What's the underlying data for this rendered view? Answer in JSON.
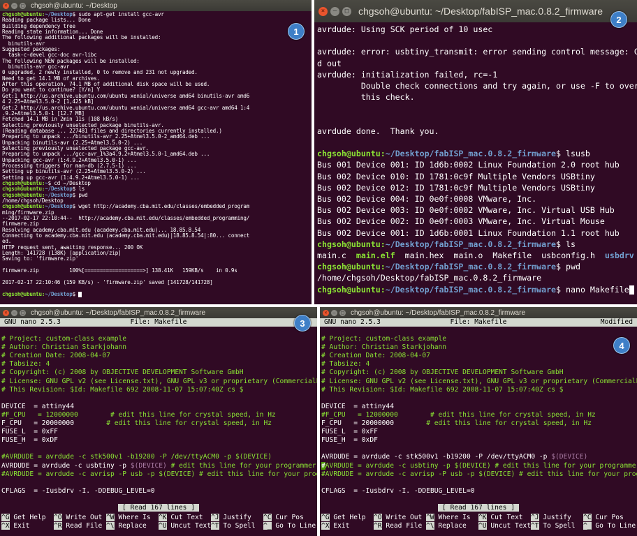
{
  "badges": [
    "1",
    "2",
    "3",
    "4"
  ],
  "window1": {
    "title": "chgsoh@ubuntu: ~/Desktop",
    "lines": [
      {
        "p": "chgsoh@ubuntu:",
        "d": "~/Desktop",
        "c": "$ sudo apt-get install gcc-avr"
      },
      {
        "t": "Reading package lists... Done"
      },
      {
        "t": "Building dependency tree"
      },
      {
        "t": "Reading state information... Done"
      },
      {
        "t": "The following additional packages will be installed:"
      },
      {
        "t": "  binutils-avr"
      },
      {
        "t": "Suggested packages:"
      },
      {
        "t": "  task-c-devel gcc-doc avr-libc"
      },
      {
        "t": "The following NEW packages will be installed:"
      },
      {
        "t": "  binutils-avr gcc-avr"
      },
      {
        "t": "0 upgraded, 2 newly installed, 0 to remove and 231 not upgraded."
      },
      {
        "t": "Need to get 14.1 MB of archives."
      },
      {
        "t": "After this operation, 74.1 MB of additional disk space will be used."
      },
      {
        "t": "Do you want to continue? [Y/n] Y"
      },
      {
        "t": "Get:1 http://us.archive.ubuntu.com/ubuntu xenial/universe amd64 binutils-avr amd6"
      },
      {
        "t": "4 2.25+Atmel3.5.0-2 [1,425 kB]"
      },
      {
        "t": "Get:2 http://us.archive.ubuntu.com/ubuntu xenial/universe amd64 gcc-avr amd64 1:4"
      },
      {
        "t": ".9.2+Atmel3.5.0-1 [12.7 MB]"
      },
      {
        "t": "Fetched 14.1 MB in 2min 11s (108 kB/s)"
      },
      {
        "t": "Selecting previously unselected package binutils-avr."
      },
      {
        "t": "(Reading database ... 227481 files and directories currently installed.)"
      },
      {
        "t": "Preparing to unpack .../binutils-avr_2.25+Atmel3.5.0-2_amd64.deb ..."
      },
      {
        "t": "Unpacking binutils-avr (2.25+Atmel3.5.0-2) ..."
      },
      {
        "t": "Selecting previously unselected package gcc-avr."
      },
      {
        "t": "Preparing to unpack .../gcc-avr_1%3a4.9.2+Atmel3.5.0-1_amd64.deb ..."
      },
      {
        "t": "Unpacking gcc-avr (1:4.9.2+Atmel3.5.0-1) ..."
      },
      {
        "t": "Processing triggers for man-db (2.7.5-1) ..."
      },
      {
        "t": "Setting up binutils-avr (2.25+Atmel3.5.0-2) ..."
      },
      {
        "t": "Setting up gcc-avr (1:4.9.2+Atmel3.5.0-1) ..."
      },
      {
        "p": "chgsoh@ubuntu:",
        "d": "~",
        "c": "$ cd ~/Desktop"
      },
      {
        "p": "chgsoh@ubuntu:",
        "d": "~/Desktop",
        "c": "$ ls"
      },
      {
        "p": "chgsoh@ubuntu:",
        "d": "~/Desktop",
        "c": "$ pwd"
      },
      {
        "t": "/home/chgsoh/Desktop"
      },
      {
        "p": "chgsoh@ubuntu:",
        "d": "~/Desktop",
        "c": "$ wget http://academy.cba.mit.edu/classes/embedded_program"
      },
      {
        "t": "ming/firmware.zip"
      },
      {
        "t": "--2017-02-17 22:10:44--  http://academy.cba.mit.edu/classes/embedded_programming/"
      },
      {
        "t": "firmware.zip"
      },
      {
        "t": "Resolving academy.cba.mit.edu (academy.cba.mit.edu)... 18.85.8.54"
      },
      {
        "t": "Connecting to academy.cba.mit.edu (academy.cba.mit.edu)|18.85.8.54|:80... connect"
      },
      {
        "t": "ed."
      },
      {
        "t": "HTTP request sent, awaiting response... 200 OK"
      },
      {
        "t": "Length: 141728 (138K) [application/zip]"
      },
      {
        "t": "Saving to: 'firmware.zip'"
      },
      {
        "t": ""
      },
      {
        "t": "firmware.zip          100%[===================>] 138.41K   159KB/s    in 0.9s"
      },
      {
        "t": ""
      },
      {
        "t": "2017-02-17 22:10:46 (159 KB/s) - 'firmware.zip' saved [141728/141728]"
      },
      {
        "t": ""
      },
      {
        "p": "chgsoh@ubuntu:",
        "d": "~/Desktop",
        "c": "$ ",
        "cursor": true
      }
    ]
  },
  "window2": {
    "title": "chgsoh@ubuntu: ~/Desktop/fabISP_mac.0.8.2_firmware",
    "lines": [
      {
        "t": "avrdude: Using SCK period of 10 usec"
      },
      {
        "t": ""
      },
      {
        "t": "avrdude: error: usbtiny_transmit: error sending control message: Connection time"
      },
      {
        "t": "d out"
      },
      {
        "t": "avrdude: initialization failed, rc=-1"
      },
      {
        "t": "         Double check connections and try again, or use -F to override"
      },
      {
        "t": "         this check."
      },
      {
        "t": ""
      },
      {
        "t": ""
      },
      {
        "t": "avrdude done.  Thank you."
      },
      {
        "t": ""
      },
      {
        "p": "chgsoh@ubuntu:",
        "d": "~/Desktop/fabISP_mac.0.8.2_firmware",
        "c": "$ lsusb"
      },
      {
        "t": "Bus 001 Device 001: ID 1d6b:0002 Linux Foundation 2.0 root hub"
      },
      {
        "t": "Bus 002 Device 010: ID 1781:0c9f Multiple Vendors USBtiny"
      },
      {
        "t": "Bus 002 Device 012: ID 1781:0c9f Multiple Vendors USBtiny"
      },
      {
        "t": "Bus 002 Device 004: ID 0e0f:0008 VMware, Inc."
      },
      {
        "t": "Bus 002 Device 003: ID 0e0f:0002 VMware, Inc. Virtual USB Hub"
      },
      {
        "t": "Bus 002 Device 002: ID 0e0f:0003 VMware, Inc. Virtual Mouse"
      },
      {
        "t": "Bus 002 Device 001: ID 1d6b:0001 Linux Foundation 1.1 root hub"
      },
      {
        "p": "chgsoh@ubuntu:",
        "d": "~/Desktop/fabISP_mac.0.8.2_firmware",
        "c": "$ ls"
      },
      {
        "ls": true
      },
      {
        "p": "chgsoh@ubuntu:",
        "d": "~/Desktop/fabISP_mac.0.8.2_firmware",
        "c": "$ pwd"
      },
      {
        "t": "/home/chgsoh/Desktop/fabISP_mac.0.8.2_firmware"
      },
      {
        "p": "chgsoh@ubuntu:",
        "d": "~/Desktop/fabISP_mac.0.8.2_firmware",
        "c": "$ nano Makefile",
        "cursor": true
      }
    ],
    "ls_files": [
      {
        "n": "main.c",
        "k": "f"
      },
      {
        "n": "main.elf",
        "k": "x"
      },
      {
        "n": "main.hex",
        "k": "f"
      },
      {
        "n": "main.o",
        "k": "f"
      },
      {
        "n": "Makefile",
        "k": "f"
      },
      {
        "n": "usbconfig.h",
        "k": "f"
      },
      {
        "n": "usbdrv",
        "k": "d"
      }
    ]
  },
  "nano": {
    "window_title": "chgsoh@ubuntu: ~/Desktop/fabISP_mac.0.8.2_firmware",
    "version": "GNU nano 2.5.3",
    "file": "File: Makefile",
    "modified_label": "Modified",
    "status": "[ Read 167 lines ]",
    "help_rows": [
      [
        {
          "k": "^G",
          "l": " Get Help"
        },
        {
          "k": "^O",
          "l": " Write Out"
        },
        {
          "k": "^W",
          "l": " Where Is"
        },
        {
          "k": "^K",
          "l": " Cut Text"
        },
        {
          "k": "^J",
          "l": " Justify"
        },
        {
          "k": "^C",
          "l": " Cur Pos"
        }
      ],
      [
        {
          "k": "^X",
          "l": " Exit"
        },
        {
          "k": "^R",
          "l": " Read File"
        },
        {
          "k": "^\\",
          "l": " Replace"
        },
        {
          "k": "^U",
          "l": " Uncut Text"
        },
        {
          "k": "^T",
          "l": " To Spell"
        },
        {
          "k": "^_",
          "l": " Go To Line"
        }
      ]
    ],
    "header_lines": [
      "# Project: custom-class example",
      "# Author: Christian Starkjohann",
      "# Creation Date: 2008-04-07",
      "# Tabsize: 4",
      "# Copyright: (c) 2008 by OBJECTIVE DEVELOPMENT Software GmbH",
      "# License: GNU GPL v2 (see License.txt), GNU GPL v3 or proprietary (CommercialL$",
      "# This Revision: $Id: Makefile 692 2008-11-07 15:07:40Z cs $"
    ],
    "device": {
      "name": "DEVICE",
      "value": "attiny44"
    },
    "fcpu_comment": "#F_CPU   = 12000000        # edit this line for crystal speed, in Hz",
    "fcpu": {
      "name": "F_CPU",
      "value": "20000000",
      "comment": "# edit this line for crystal speed, in Hz"
    },
    "fuse_l": {
      "name": "FUSE_L",
      "value": "0xFF"
    },
    "fuse_h": {
      "name": "FUSE_H",
      "value": "0xDF"
    },
    "avrdude_comment1": "#AVRDUDE = avrdude -c stk500v1 -b19200 -P /dev/ttyACM0 -p $(DEVICE)",
    "avrdude_active": {
      "name": "AVRDUDE",
      "pre": "avrdude -c usbtiny -p ",
      "var": "$(DEVICE)",
      "post": " # edit this line for your programmer"
    },
    "avrdude_comment2": "#AVRDUDE = avrdude -c avrisp -P usb -p $(DEVICE) # edit this line for your prog$",
    "cflags": {
      "name": "CFLAGS",
      "value": "-Iusbdrv -I. -DDEBUG_LEVEL=0"
    },
    "w4_avrdude_line1": {
      "name": "AVRDUDE",
      "pre": "avrdude -c stk500v1 -b19200 -P /dev/ttyACM0 -p ",
      "var": "$(DEVICE)"
    },
    "w4_avrdude_line2": "#AVRDUDE = avrdude -c usbtiny -p $(DEVICE) # edit this line for your programmer",
    "w4_avrdude_line2_rest": "AVRDUDE = avrdude -c usbtiny -p $(DEVICE) # edit this line for your programmer"
  }
}
